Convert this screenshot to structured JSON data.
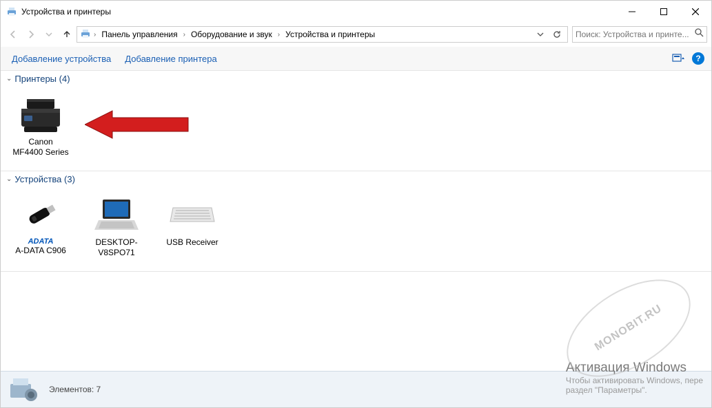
{
  "window": {
    "title": "Устройства и принтеры"
  },
  "nav": {
    "breadcrumbs": [
      "Панель управления",
      "Оборудование и звук",
      "Устройства и принтеры"
    ]
  },
  "search": {
    "placeholder": "Поиск: Устройства и принте..."
  },
  "toolbar": {
    "add_device": "Добавление устройства",
    "add_printer": "Добавление принтера"
  },
  "groups": [
    {
      "title": "Принтеры (4)",
      "items": [
        {
          "label": "Canon MF4400 Series",
          "icon": "printer"
        }
      ]
    },
    {
      "title": "Устройства (3)",
      "items": [
        {
          "label": "A-DATA C906",
          "icon": "usb-drive",
          "brand": "ADATA"
        },
        {
          "label": "DESKTOP-V8SPO71",
          "icon": "laptop"
        },
        {
          "label": "USB Receiver",
          "icon": "keyboard"
        }
      ]
    }
  ],
  "status": {
    "text": "Элементов: 7"
  },
  "watermark": {
    "line1": "Активация Windows",
    "line2": "Чтобы активировать Windows, пере",
    "line3": "раздел \"Параметры\"."
  },
  "stamp": "MONOBIT.RU"
}
